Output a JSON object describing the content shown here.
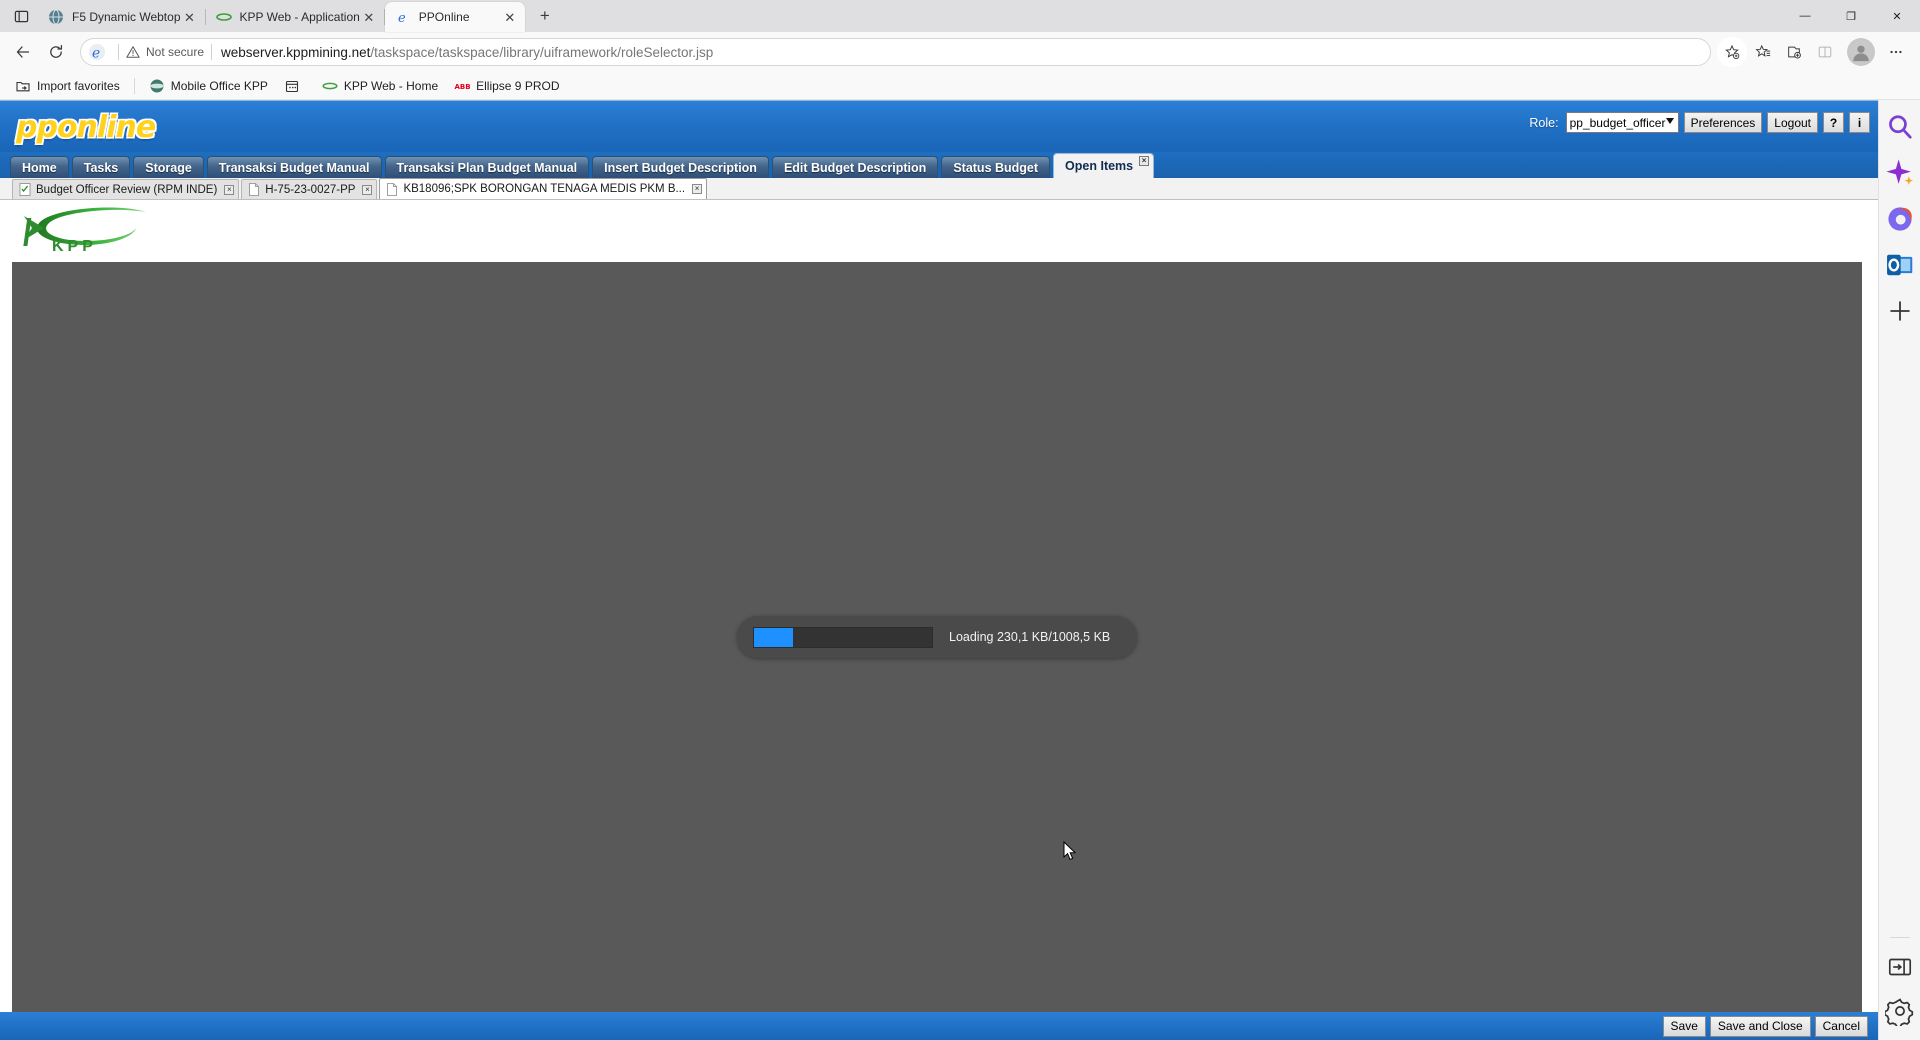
{
  "browser": {
    "tab_search_icon": "tab-search-icon",
    "tabs": [
      {
        "title": "F5 Dynamic Webtop",
        "favicon": "f5-globe-icon",
        "active": false,
        "close_label": "✕"
      },
      {
        "title": "KPP Web - Application",
        "favicon": "kpp-swoosh-icon",
        "active": false,
        "close_label": "✕"
      },
      {
        "title": "PPOnline",
        "favicon": "edge-legacy-icon",
        "active": true,
        "close_label": "✕"
      }
    ],
    "new_tab_label": "+",
    "window_controls": {
      "minimize": "—",
      "restore": "❐",
      "close": "✕"
    },
    "nav": {
      "back_label": "←",
      "refresh_label": "↻",
      "security_text": "Not secure",
      "url_host": "webserver.kppmining.net",
      "url_path": "/taskspace/taskspace/library/uiframework/roleSelector.jsp",
      "url_full": "webserver.kppmining.net/taskspace/taskspace/library/uiframework/roleSelector.jsp"
    },
    "toolbar_icons": [
      "add-favorite-icon",
      "favorites-icon",
      "collections-icon",
      "split-screen-icon",
      "profile-avatar",
      "more-options-icon"
    ],
    "bookmarks": [
      {
        "label": "Import favorites",
        "icon": "import-favorites-icon"
      },
      {
        "label": "Mobile Office KPP",
        "icon": "mobile-office-icon"
      },
      {
        "label": "",
        "icon": "calendar-icon"
      },
      {
        "label": "KPP Web - Home",
        "icon": "kpp-swoosh-icon"
      },
      {
        "label": "Ellipse 9 PROD",
        "icon": "abb-icon"
      }
    ],
    "sidebar_icons": [
      "search-icon",
      "copilot-sparkle-icon",
      "microsoft365-icon",
      "outlook-icon",
      "add-sidebar-icon"
    ],
    "sidebar_bottom_icons": [
      "toggle-sidebar-icon",
      "settings-gear-icon"
    ]
  },
  "app": {
    "logo_text": "pponline",
    "role": {
      "label": "Role:",
      "selected": "pp_budget_officer",
      "options": [
        "pp_budget_officer"
      ]
    },
    "header_buttons": [
      {
        "name": "preferences",
        "label": "Preferences"
      },
      {
        "name": "logout",
        "label": "Logout"
      },
      {
        "name": "help",
        "label": "?"
      },
      {
        "name": "info",
        "label": "i"
      }
    ],
    "nav_tabs": [
      {
        "label": "Home",
        "active": false
      },
      {
        "label": "Tasks",
        "active": false
      },
      {
        "label": "Storage",
        "active": false
      },
      {
        "label": "Transaksi Budget Manual",
        "active": false
      },
      {
        "label": "Transaksi Plan Budget Manual",
        "active": false
      },
      {
        "label": "Insert Budget Description",
        "active": false
      },
      {
        "label": "Edit Budget Description",
        "active": false
      },
      {
        "label": "Status Budget",
        "active": false
      },
      {
        "label": "Open Items",
        "active": true,
        "close_label": "☒"
      }
    ],
    "sub_tabs": [
      {
        "label": "Budget Officer Review (RPM INDE)",
        "icon": "checklist-doc-icon",
        "active": false,
        "close_label": "☒"
      },
      {
        "label": "H-75-23-0027-PP",
        "icon": "document-icon",
        "active": false,
        "close_label": "☒"
      },
      {
        "label": "KB18096;SPK BORONGAN TENAGA MEDIS PKM B...",
        "icon": "document-icon",
        "active": true,
        "close_label": "☒"
      }
    ],
    "brand": {
      "logo_alt": "KPP",
      "logo_text": "KPP",
      "color": "#2e8b2e"
    },
    "loading": {
      "text": "Loading 230,1 KB/1008,5 KB",
      "loaded_kb": "230,1 KB",
      "total_kb": "1008,5 KB",
      "percent": 22,
      "bar_color": "#1e90ff"
    },
    "footer_buttons": [
      {
        "name": "save",
        "label": "Save"
      },
      {
        "name": "save-and-close",
        "label": "Save and Close"
      },
      {
        "name": "cancel",
        "label": "Cancel"
      }
    ]
  },
  "colors": {
    "app_blue": "#1f6fc4",
    "tab_blue": "#44648a",
    "content_gray": "#595959",
    "accent": "#1e90ff",
    "logo_yellow": "#ffd21e",
    "kpp_green": "#2e8b2e"
  }
}
